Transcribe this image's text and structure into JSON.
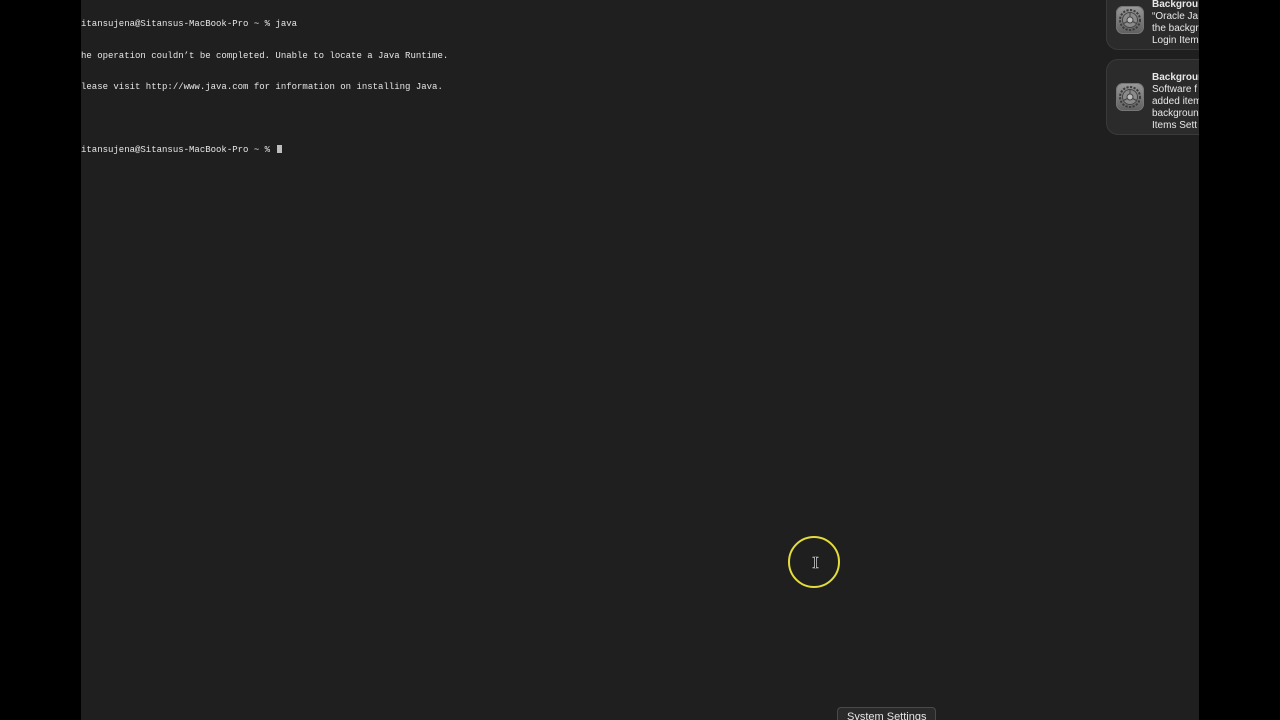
{
  "terminal": {
    "lines": [
      "itansujena@Sitansus-MacBook-Pro ~ % java",
      "he operation couldn’t be completed. Unable to locate a Java Runtime.",
      "lease visit http://www.java.com for information on installing Java.",
      "",
      "itansujena@Sitansus-MacBook-Pro ~ % "
    ]
  },
  "notifications": [
    {
      "title": "Backgrou",
      "body": "“Oracle Ja\nthe backgr\nLogin Item",
      "icon": "gear-icon"
    },
    {
      "title": "Backgroun",
      "body": "Software f\nadded item\nbackgroun\nItems Sett",
      "icon": "gear-icon"
    }
  ],
  "tooltip": {
    "label": "System Settings"
  },
  "colors": {
    "background": "#1f1f1f",
    "click_indicator": "#e4dc3c"
  }
}
